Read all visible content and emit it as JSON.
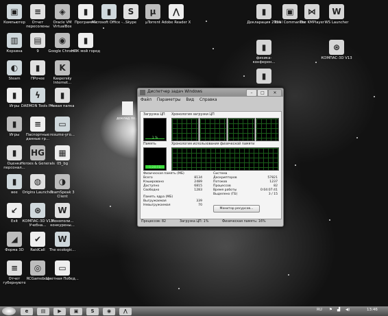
{
  "desktop": {
    "icons": [
      {
        "label": "Компьютер",
        "glyph": "▣",
        "col": 0,
        "row": 0
      },
      {
        "label": "Отчет пересолены",
        "glyph": "≡",
        "col": 1,
        "row": 0
      },
      {
        "label": "Oracle VM VirtualBox",
        "glyph": "◈",
        "col": 2,
        "row": 0
      },
      {
        "label": "Программы",
        "glyph": "▮",
        "col": 3,
        "row": 0
      },
      {
        "label": "Microsoft Office -...",
        "glyph": "▮",
        "col": 4,
        "row": 0
      },
      {
        "label": "Skype",
        "glyph": "S",
        "col": 5,
        "row": 0
      },
      {
        "label": "µTorrent",
        "glyph": "µ",
        "col": 6,
        "row": 0
      },
      {
        "label": "Adobe Reader X",
        "glyph": "⋀",
        "col": 7,
        "row": 0
      },
      {
        "label": "Корзина",
        "glyph": "▥",
        "col": 0,
        "row": 1
      },
      {
        "label": "9",
        "glyph": "▤",
        "col": 1,
        "row": 1
      },
      {
        "label": "Google Chrome",
        "glyph": "◉",
        "col": 2,
        "row": 1
      },
      {
        "label": "НПК мой город",
        "glyph": "▮",
        "col": 3,
        "row": 1
      },
      {
        "label": "Steam",
        "glyph": "◐",
        "col": 0,
        "row": 2
      },
      {
        "label": "ПРочее",
        "glyph": "▮",
        "col": 1,
        "row": 2
      },
      {
        "label": "Kaspersky Internet...",
        "glyph": "K",
        "col": 2,
        "row": 2
      },
      {
        "label": "Игры",
        "glyph": "▮",
        "col": 0,
        "row": 3
      },
      {
        "label": "DAEMON Tools Pro",
        "glyph": "ϟ",
        "col": 1,
        "row": 3
      },
      {
        "label": "Новая папка",
        "glyph": "▮",
        "col": 2,
        "row": 3
      },
      {
        "label": "Игры",
        "glyph": "▮",
        "col": 0,
        "row": 4
      },
      {
        "label": "Паспортные данные гр...",
        "glyph": "≡",
        "col": 1,
        "row": 4
      },
      {
        "label": "resume-уго...",
        "glyph": "▭",
        "col": 2,
        "row": 4
      },
      {
        "label": "Оценка персонал...",
        "glyph": "▮",
        "col": 0,
        "row": 5
      },
      {
        "label": "Heroes & Generals",
        "glyph": "HG",
        "col": 1,
        "row": 5
      },
      {
        "label": "05_bg",
        "glyph": "▦",
        "col": 2,
        "row": 5
      },
      {
        "label": "вее",
        "glyph": "▮",
        "col": 0,
        "row": 6
      },
      {
        "label": "Origins Launcher",
        "glyph": "◍",
        "col": 1,
        "row": 6
      },
      {
        "label": "TeamSpeak 3 Client",
        "glyph": "◑",
        "col": 2,
        "row": 6
      },
      {
        "label": "Exit",
        "glyph": "↙",
        "col": 0,
        "row": 7
      },
      {
        "label": "КОМПАС-3D V13 Учебна...",
        "glyph": "⊛",
        "col": 1,
        "row": 7
      },
      {
        "label": "Монополи... конкурены...",
        "glyph": "W",
        "col": 2,
        "row": 7
      },
      {
        "label": "Форма 3D",
        "glyph": "◢",
        "col": 0,
        "row": 8
      },
      {
        "label": "RaidCall",
        "glyph": "✔",
        "col": 1,
        "row": 8
      },
      {
        "label": "The ecologic...",
        "glyph": "W",
        "col": 2,
        "row": 8
      },
      {
        "label": "Отчет губернуюте",
        "glyph": "≡",
        "col": 0,
        "row": 9
      },
      {
        "label": "RCGamebox",
        "glyph": "◎",
        "col": 1,
        "row": 9
      },
      {
        "label": "Цветная Побед...",
        "glyph": "▭",
        "col": 2,
        "row": 9
      }
    ],
    "right_icons": [
      {
        "label": "Декларация 2014",
        "glyph": "▮"
      },
      {
        "label": "Total Commander",
        "glyph": "▣"
      },
      {
        "label": "The KMPlayer",
        "glyph": "⋈"
      },
      {
        "label": "WS Launcher",
        "glyph": "W"
      },
      {
        "label": "физика-конферен...",
        "glyph": "▮"
      },
      {
        "label": "КОМПАС-3D V13",
        "glyph": "⊛"
      },
      {
        "label": "",
        "glyph": "▮"
      }
    ],
    "doc_label": "доклад по..."
  },
  "task_manager": {
    "title": "Диспетчер задач Windows",
    "menu": [
      "Файл",
      "Параметры",
      "Вид",
      "Справка"
    ],
    "tabs": [
      "Приложения",
      "Процессы",
      "Службы",
      "Быстродействие",
      "Сеть",
      "Пользователи"
    ],
    "active_tab": "Быстродействие",
    "cpu_label": "Загрузка ЦП",
    "cpu_value": "1 %",
    "cpu_history_label": "Хронология загрузки ЦП",
    "mem_label": "Память",
    "mem_value": "1,28 ГБ",
    "mem_history_label": "Хронология использования физической памяти",
    "physical_memory": {
      "heading": "Физическая память (МБ)",
      "rows": [
        [
          "Всего",
          "8134"
        ],
        [
          "Кэшировано",
          "2489"
        ],
        [
          "Доступно",
          "6815"
        ],
        [
          "Свободно",
          "1283"
        ]
      ]
    },
    "system": {
      "heading": "Система",
      "rows": [
        [
          "Дескрипторов",
          "57821"
        ],
        [
          "Потоков",
          "1237"
        ],
        [
          "Процессов",
          "82"
        ],
        [
          "Время работы",
          "0:04:07:41"
        ],
        [
          "Выделено (ГБ)",
          "3 / 15"
        ]
      ]
    },
    "kernel_memory": {
      "heading": "Память ядра (МБ)",
      "rows": [
        [
          "Выгружаемая",
          "339"
        ],
        [
          "Невыгружаемая",
          "70"
        ]
      ]
    },
    "resource_monitor_button": "Монитор ресурсов...",
    "status": {
      "processes": "Процессов: 82",
      "cpu": "Загрузка ЦП: 1%",
      "memory": "Физическая память: 16%"
    }
  },
  "taskbar": {
    "lang": "RU",
    "time": "13:46",
    "apps": [
      "e",
      "▤",
      "▶",
      "▣",
      "S",
      "◉",
      "⋀"
    ]
  }
}
